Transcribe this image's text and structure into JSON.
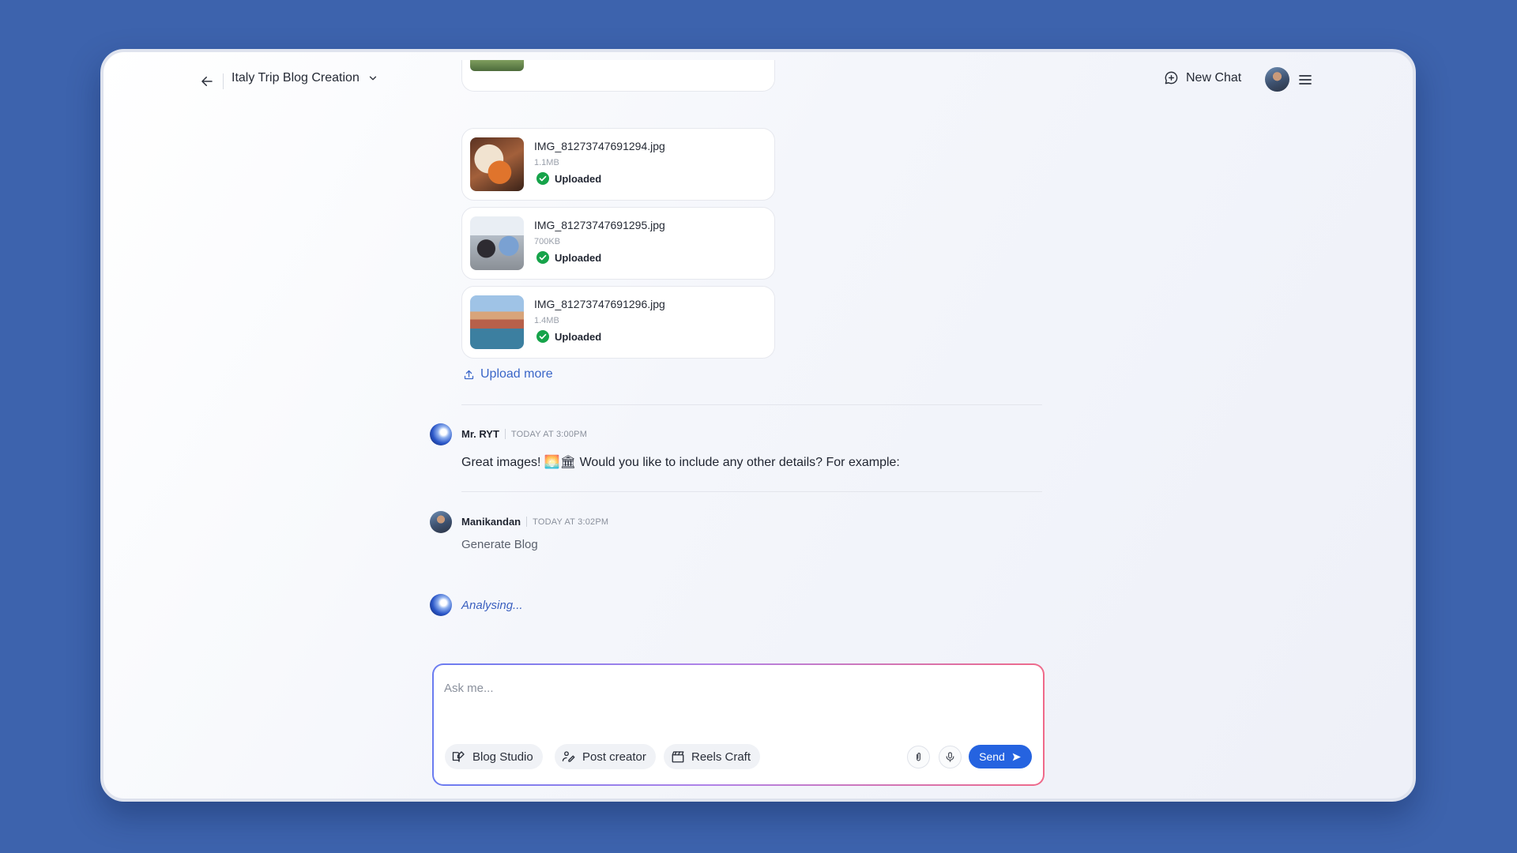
{
  "header": {
    "title": "Italy Trip Blog Creation",
    "new_chat_label": "New Chat"
  },
  "files": [
    {
      "name": "IMG_81273747691294.jpg",
      "size": "1.1MB",
      "status": "Uploaded"
    },
    {
      "name": "IMG_81273747691295.jpg",
      "size": "700KB",
      "status": "Uploaded"
    },
    {
      "name": "IMG_81273747691296.jpg",
      "size": "1.4MB",
      "status": "Uploaded"
    }
  ],
  "upload_more_label": "Upload more",
  "messages": [
    {
      "author": "Mr. RYT",
      "time": "TODAY AT 3:00PM",
      "text": "Great images! 🌅🏛 Would you like to include any other details? For example:"
    },
    {
      "author": "Manikandan",
      "time": "TODAY AT 3:02PM",
      "text": "Generate Blog"
    }
  ],
  "status_text": "Analysing...",
  "composer": {
    "placeholder": "Ask me...",
    "tools": [
      "Blog Studio",
      "Post creator",
      "Reels Craft"
    ],
    "send_label": "Send"
  },
  "colors": {
    "background": "#3d63ad",
    "accent": "#2563e0",
    "success": "#16a34a",
    "link": "#3a66c8"
  }
}
